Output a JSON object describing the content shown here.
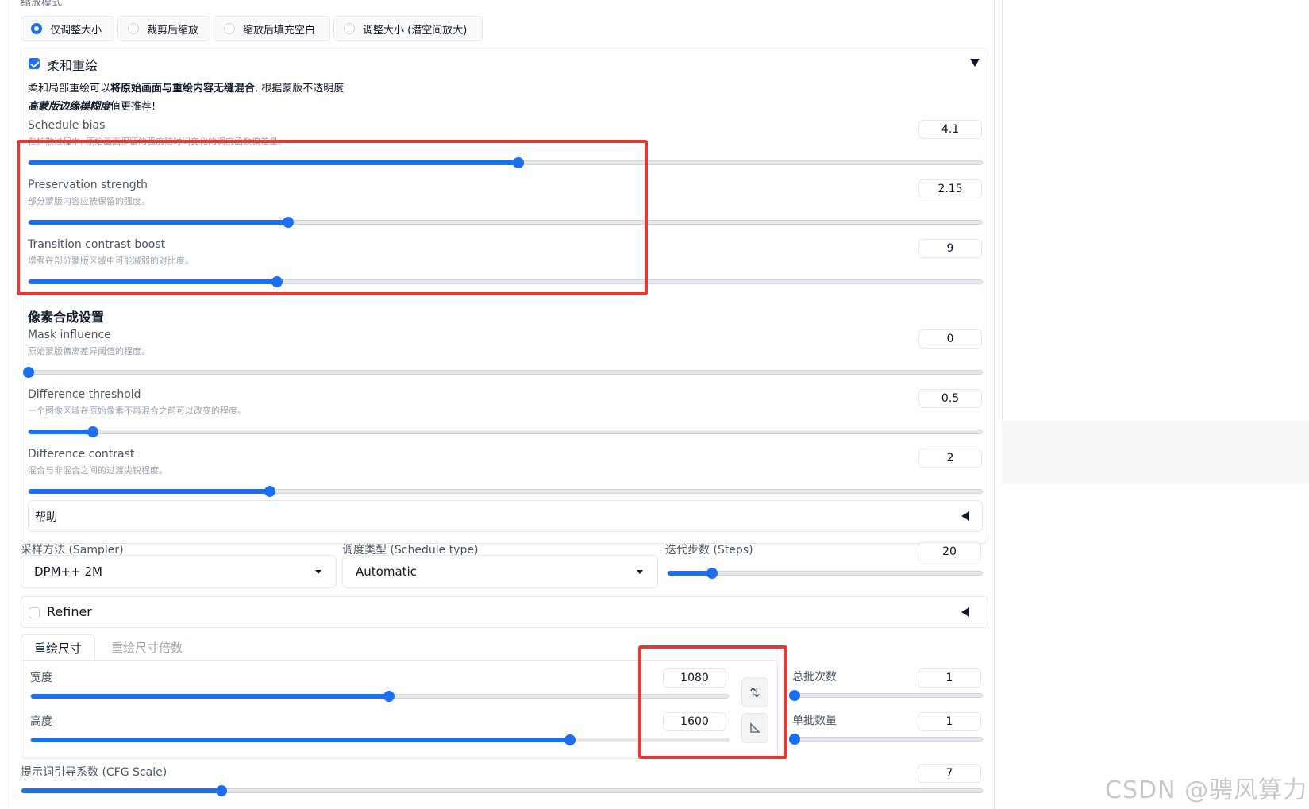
{
  "resize_mode": {
    "label": "缩放模式",
    "options": [
      {
        "label": "仅调整大小",
        "checked": true
      },
      {
        "label": "裁剪后缩放",
        "checked": false
      },
      {
        "label": "缩放后填充空白",
        "checked": false
      },
      {
        "label": "调整大小 (潜空间放大)",
        "checked": false
      }
    ]
  },
  "soft_inpaint": {
    "title": "柔和重绘",
    "enabled": true,
    "desc_line1_pre": "柔和局部重绘可以",
    "desc_line1_bold": "将原始画面与重绘内容无缝混合",
    "desc_line1_post": ", 根据蒙版不透明度",
    "desc_line2_bold": "高蒙版边缘模糊度",
    "desc_line2_post": "值更推荐!",
    "params": [
      {
        "label": "Schedule bias",
        "hint": "在扩散过程中, 原始画面保留的强度随时间变化的调度函数偏差量。",
        "value": "4.1",
        "fraction": 0.513
      },
      {
        "label": "Preservation strength",
        "hint": "部分蒙版内容应被保留的强度。",
        "value": "2.15",
        "fraction": 0.272
      },
      {
        "label": "Transition contrast boost",
        "hint": "增强在部分蒙版区域中可能减弱的对比度。",
        "value": "9",
        "fraction": 0.26
      }
    ],
    "pixel_section_title": "像素合成设置",
    "pixel_params": [
      {
        "label": "Mask influence",
        "hint": "原始蒙版偏离差异阈值的程度。",
        "value": "0",
        "fraction": 0.0
      },
      {
        "label": "Difference threshold",
        "hint": "一个图像区域在原始像素不再混合之前可以改变的程度。",
        "value": "0.5",
        "fraction": 0.067
      },
      {
        "label": "Difference contrast",
        "hint": "混合与非混合之间的过渡尖锐程度。",
        "value": "2",
        "fraction": 0.253
      }
    ],
    "help_label": "帮助"
  },
  "sampler": {
    "label": "采样方法 (Sampler)",
    "value": "DPM++ 2M"
  },
  "schedule_type": {
    "label": "调度类型 (Schedule type)",
    "value": "Automatic"
  },
  "steps": {
    "label": "迭代步数 (Steps)",
    "value": "20",
    "fraction": 0.14
  },
  "refiner": {
    "label": "Refiner",
    "enabled": false
  },
  "tabs": [
    {
      "label": "重绘尺寸",
      "active": true
    },
    {
      "label": "重绘尺寸倍数",
      "active": false
    }
  ],
  "width": {
    "label": "宽度",
    "value": "1080",
    "fraction": 0.512
  },
  "height": {
    "label": "高度",
    "value": "1600",
    "fraction": 0.772
  },
  "swap_icon": "swap-vertical-icon",
  "ratio_icon": "aspect-ratio-icon",
  "batch_count": {
    "label": "总批次数",
    "value": "1",
    "fraction": 0.0
  },
  "batch_size": {
    "label": "单批数量",
    "value": "1",
    "fraction": 0.0
  },
  "cfg_scale": {
    "label": "提示词引导系数 (CFG Scale)",
    "value": "7",
    "fraction": 0.208
  },
  "watermark": "CSDN @骋风算力",
  "colors": {
    "accent": "#1d6ff2",
    "highlight_box": "#e53935"
  }
}
